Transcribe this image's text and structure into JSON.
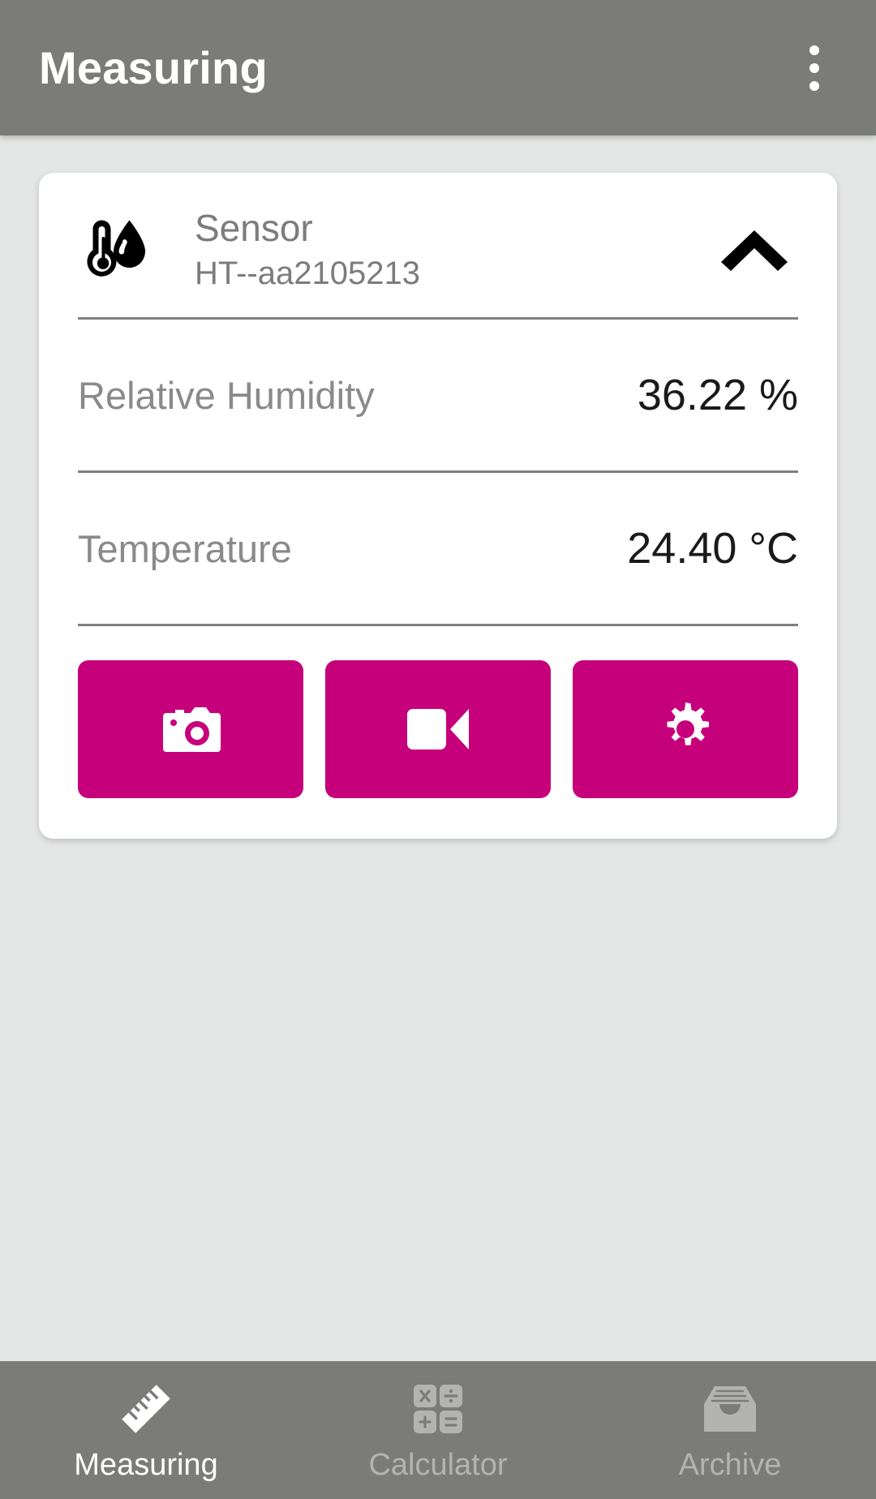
{
  "appbar": {
    "title": "Measuring",
    "overflow_icon": "more-vert-icon"
  },
  "colors": {
    "appbar_background": "#7b7b79",
    "page_background": "#e5e6e6",
    "card_background": "#ffffff",
    "accent_magenta": "#c6007b",
    "label_gray": "#8a8a8a",
    "value_black": "#1a1a1a",
    "divider_gray": "#7f7f7f",
    "nav_active": "#ffffff",
    "nav_inactive": "#b3b3b1"
  },
  "card": {
    "sensor": {
      "icon": "thermometer-humidity-icon",
      "name": "Sensor",
      "id": "HT--aa2105213",
      "collapse_icon": "chevron-up-icon"
    },
    "measurements": [
      {
        "label": "Relative Humidity",
        "value": "36.22 %"
      },
      {
        "label": "Temperature",
        "value": "24.40 °C"
      }
    ],
    "actions": [
      {
        "icon": "camera-icon",
        "name": "photo-capture-button"
      },
      {
        "icon": "video-camera-icon",
        "name": "video-capture-button"
      },
      {
        "icon": "gear-icon",
        "name": "sensor-settings-button"
      }
    ]
  },
  "bottom_nav": {
    "items": [
      {
        "label": "Measuring",
        "icon": "ruler-icon",
        "active": true
      },
      {
        "label": "Calculator",
        "icon": "calculator-icon",
        "active": false
      },
      {
        "label": "Archive",
        "icon": "archive-icon",
        "active": false
      }
    ]
  }
}
